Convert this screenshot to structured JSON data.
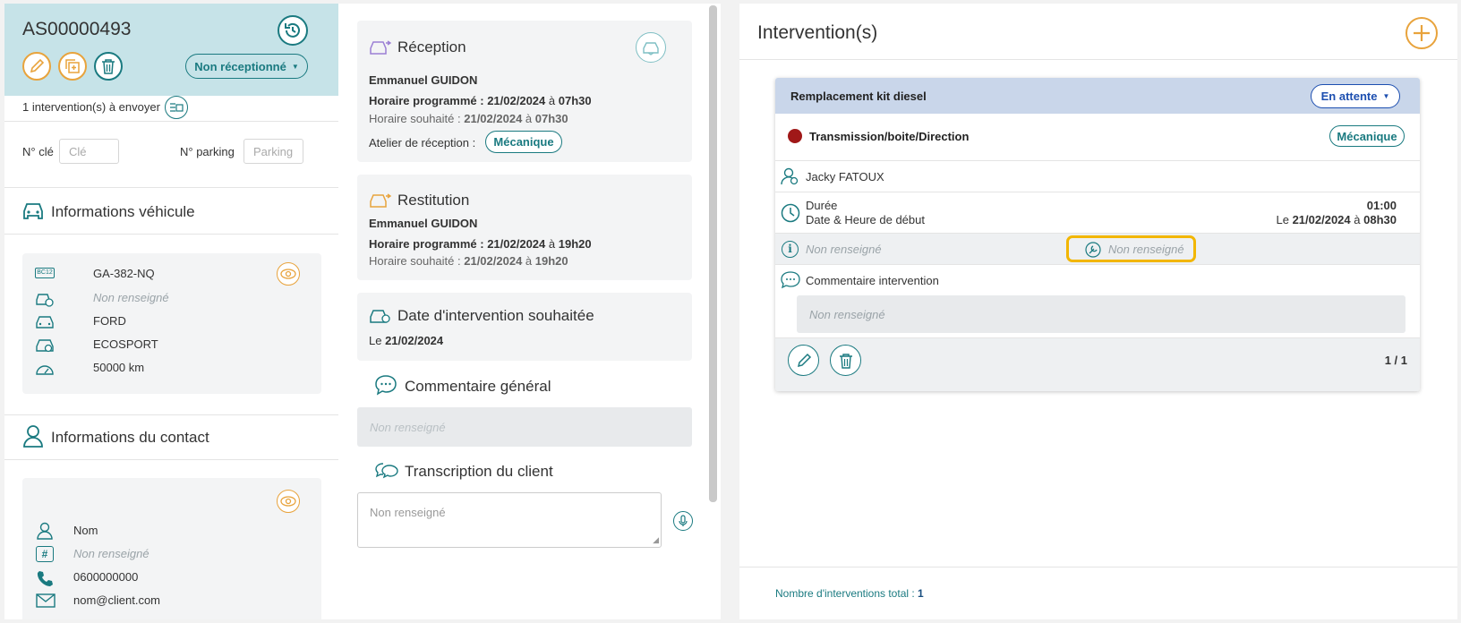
{
  "left": {
    "title": "AS00000493",
    "status_label": "Non réceptionné",
    "interventions_to_send": "1 intervention(s) à envoyer",
    "key_label": "N° clé",
    "key_placeholder": "Clé",
    "parking_label": "N° parking",
    "parking_placeholder": "Parking",
    "vehicle_section_title": "Informations véhicule",
    "vehicle": {
      "plate_icon_text": "BC12",
      "plate": "GA-382-NQ",
      "vin": "Non renseigné",
      "brand": "FORD",
      "model": "ECOSPORT",
      "mileage": "50000 km"
    },
    "contact_section_title": "Informations du contact",
    "contact": {
      "name": "Nom",
      "id": "Non renseigné",
      "phone": "0600000000",
      "email": "nom@client.com"
    }
  },
  "middle": {
    "reception": {
      "title": "Réception",
      "person": "Emmanuel GUIDON",
      "scheduled_label": "Horaire programmé : ",
      "scheduled_date": "21/02/2024",
      "scheduled_sep": " à ",
      "scheduled_time": "07h30",
      "wished_label": "Horaire souhaité : ",
      "wished_date": "21/02/2024",
      "wished_sep": " à ",
      "wished_time": "07h30",
      "workshop_label": "Atelier de réception :",
      "workshop_value": "Mécanique"
    },
    "restitution": {
      "title": "Restitution",
      "person": "Emmanuel GUIDON",
      "scheduled_label": "Horaire programmé : ",
      "scheduled_date": "21/02/2024",
      "scheduled_sep": " à ",
      "scheduled_time": "19h20",
      "wished_label": "Horaire souhaité : ",
      "wished_date": "21/02/2024",
      "wished_sep": " à ",
      "wished_time": "19h20"
    },
    "wished_date": {
      "title": "Date d'intervention souhaitée",
      "prefix": "Le ",
      "date": "21/02/2024"
    },
    "general_comment": {
      "title": "Commentaire général",
      "value": "Non renseigné"
    },
    "transcription": {
      "title": "Transcription du client",
      "placeholder": "Non renseigné"
    }
  },
  "right": {
    "title": "Intervention(s)",
    "card": {
      "name": "Remplacement kit diesel",
      "status": "En attente",
      "category": "Transmission/boite/Direction",
      "category_dot_color": "#a01818",
      "workshop": "Mécanique",
      "technician": "Jacky FATOUX",
      "duration_label": "Durée",
      "duration_value": "01:00",
      "start_label": "Date & Heure de début",
      "start_prefix": "Le ",
      "start_date": "21/02/2024",
      "start_sep": " à ",
      "start_time": "08h30",
      "info_value": "Non renseigné",
      "tool_value": "Non renseigné",
      "comment_label": "Commentaire intervention",
      "comment_value": "Non renseigné",
      "pagination": "1 / 1"
    },
    "total_label": "Nombre d'interventions total : ",
    "total_value": "1"
  },
  "colors": {
    "teal": "#1a7a80",
    "orange": "#e8a33c",
    "header_bg": "#c6e3e8",
    "card_header_bg": "#c9d6ea",
    "status_blue": "#1d4fb0",
    "highlight": "#f2b600"
  }
}
